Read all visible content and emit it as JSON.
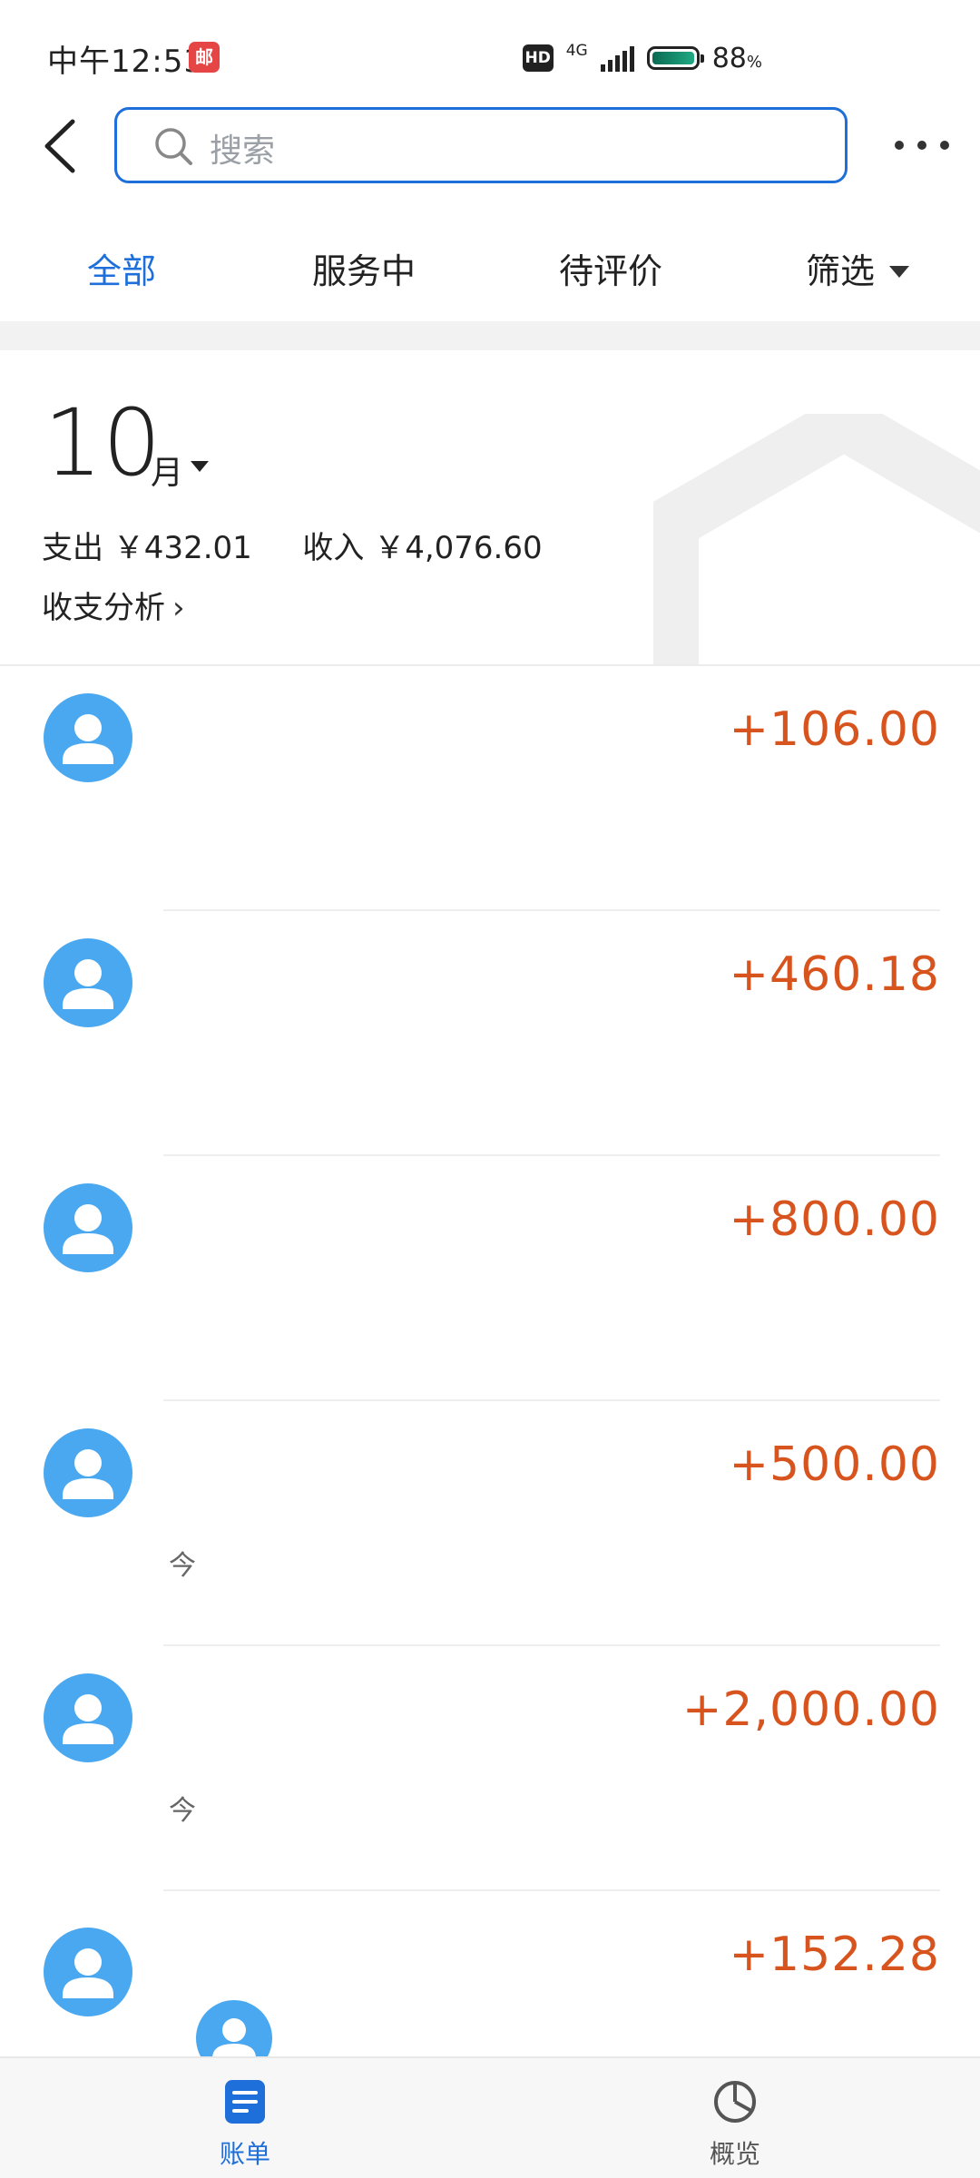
{
  "status_bar": {
    "time": "中午12:53",
    "mail_badge": "邮",
    "hd": "HD",
    "network": "4G",
    "battery_percent": "88",
    "battery_unit": "%"
  },
  "header": {
    "search_placeholder": "搜索"
  },
  "tabs": [
    {
      "label": "全部",
      "active": true
    },
    {
      "label": "服务中",
      "active": false
    },
    {
      "label": "待评价",
      "active": false
    },
    {
      "label": "筛选",
      "active": false
    }
  ],
  "summary": {
    "month": "10",
    "month_unit": "月",
    "expense_label": "支出",
    "expense_value": "￥432.01",
    "income_label": "收入",
    "income_value": "￥4,076.60",
    "analysis_link": "收支分析",
    "analysis_chevron": "›"
  },
  "transactions": [
    {
      "amount": "+106.00",
      "meta": ""
    },
    {
      "amount": "+460.18",
      "meta": ""
    },
    {
      "amount": "+800.00",
      "meta": ""
    },
    {
      "amount": "+500.00",
      "meta": "今"
    },
    {
      "amount": "+2,000.00",
      "meta": "今"
    },
    {
      "amount": "+152.28",
      "meta": ""
    }
  ],
  "bottom_nav": {
    "bills_label": "账单",
    "overview_label": "概览"
  },
  "colors": {
    "accent": "#1e6fd9",
    "amount": "#d8541e",
    "avatar": "#4aa8f0"
  }
}
